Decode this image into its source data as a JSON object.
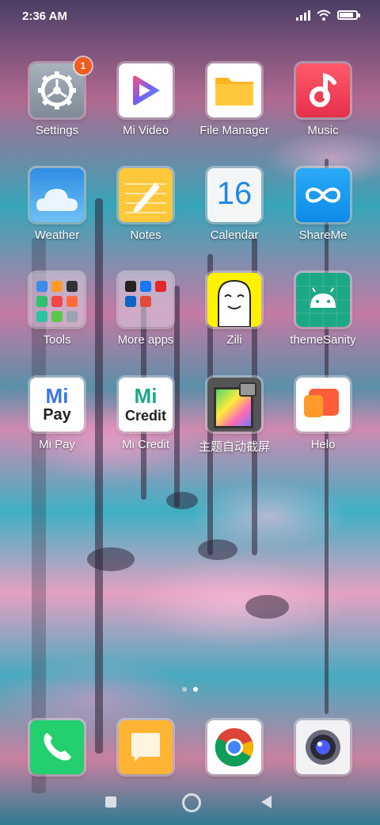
{
  "status_bar": {
    "time": "2:36 AM",
    "battery_level": 0.85
  },
  "apps": [
    {
      "label": "Settings",
      "icon": "gear-icon",
      "badge": "1"
    },
    {
      "label": "Mi Video",
      "icon": "play-icon"
    },
    {
      "label": "File Manager",
      "icon": "folder-icon"
    },
    {
      "label": "Music",
      "icon": "music-note-icon"
    },
    {
      "label": "Weather",
      "icon": "cloud-icon"
    },
    {
      "label": "Notes",
      "icon": "pencil-icon"
    },
    {
      "label": "Calendar",
      "icon": "calendar-icon",
      "day": "16"
    },
    {
      "label": "ShareMe",
      "icon": "infinity-icon"
    },
    {
      "label": "Tools",
      "icon": "folder-tools-icon"
    },
    {
      "label": "More apps",
      "icon": "folder-more-apps-icon"
    },
    {
      "label": "Zili",
      "icon": "zili-face-icon"
    },
    {
      "label": "themeSanity",
      "icon": "android-icon"
    },
    {
      "label": "Mi Pay",
      "icon": "mi-pay-logo",
      "logo_top": "Mi",
      "logo_bottom": "Pay"
    },
    {
      "label": "Mi Credit",
      "icon": "mi-credit-logo",
      "logo_top": "Mi",
      "logo_bottom": "Credit"
    },
    {
      "label": "主题自动截屏",
      "icon": "screenshot-icon"
    },
    {
      "label": "Helo",
      "icon": "helo-chat-icon"
    }
  ],
  "page_indicator": {
    "pages": 2,
    "current": 2
  },
  "dock": [
    {
      "name": "phone",
      "icon": "phone-icon"
    },
    {
      "name": "messages",
      "icon": "message-icon"
    },
    {
      "name": "chrome",
      "icon": "chrome-icon"
    },
    {
      "name": "camera",
      "icon": "camera-icon"
    }
  ],
  "colors": {
    "badge": "#f25c1d",
    "settings_bg": "#8e99a6",
    "mivideo_accent": "#7b5cf0",
    "filemanager": "#ffb51e",
    "music": "#ee3b4f",
    "weather": "#3c9be8",
    "notes": "#ffc83a",
    "shareme": "#1c9cf0",
    "themesanity": "#1ba885",
    "helo": "#ff5d3a",
    "phone": "#23cf6e",
    "messages": "#ffb533"
  }
}
